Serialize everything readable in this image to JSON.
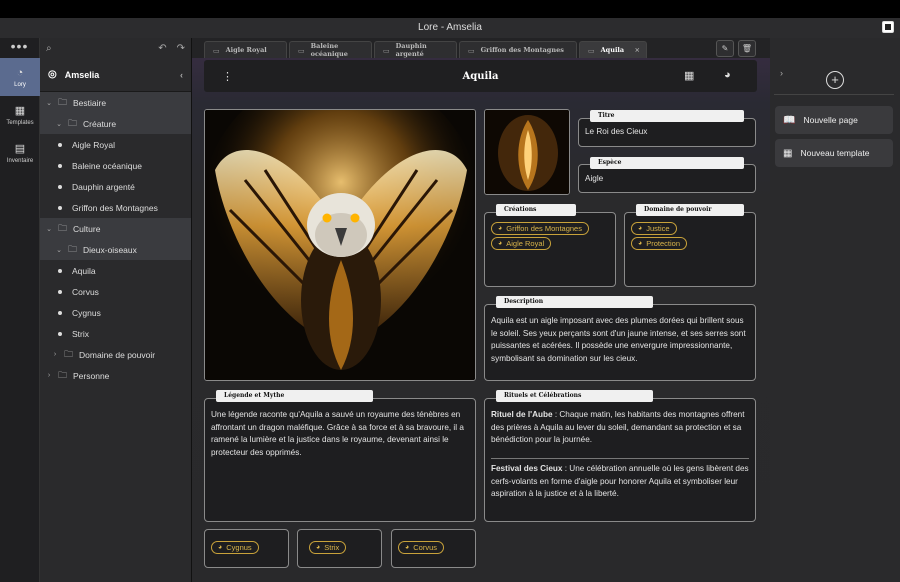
{
  "window": {
    "title": "Lore - Amselia"
  },
  "rail": {
    "items": [
      {
        "label": "Lory",
        "icon": "lory-icon"
      },
      {
        "label": "Templates",
        "icon": "templates-icon"
      },
      {
        "label": "Inventaire",
        "icon": "inventory-icon"
      }
    ]
  },
  "tree": {
    "workspace": "Amselia",
    "nodes": [
      {
        "label": "Bestiaire"
      },
      {
        "label": "Créature"
      },
      {
        "label": "Aigle Royal"
      },
      {
        "label": "Baleine océanique"
      },
      {
        "label": "Dauphin argenté"
      },
      {
        "label": "Griffon des Montagnes"
      },
      {
        "label": "Culture"
      },
      {
        "label": "Dieux-oiseaux"
      },
      {
        "label": "Aquila"
      },
      {
        "label": "Corvus"
      },
      {
        "label": "Cygnus"
      },
      {
        "label": "Strix"
      },
      {
        "label": "Domaine de pouvoir"
      },
      {
        "label": "Personne"
      }
    ]
  },
  "tabs": [
    {
      "label": "Aigle Royal"
    },
    {
      "label": "Baleine océanique"
    },
    {
      "label": "Dauphin argenté"
    },
    {
      "label": "Griffon des Montagnes"
    },
    {
      "label": "Aquila"
    }
  ],
  "page": {
    "title": "Aquila",
    "titre": {
      "label": "Titre",
      "value": "Le Roi des Cieux"
    },
    "espece": {
      "label": "Espèce",
      "value": "Aigle"
    },
    "creations": {
      "label": "Créations",
      "chips": [
        "Griffon des Montagnes",
        "Aigle Royal"
      ]
    },
    "domaine": {
      "label": "Domaine de pouvoir",
      "chips": [
        "Justice",
        "Protection"
      ]
    },
    "description": {
      "label": "Description",
      "text": "Aquila est un aigle imposant avec des plumes dorées qui brillent sous le soleil. Ses yeux perçants sont d'un jaune intense, et ses serres sont puissantes et acérées. Il possède une envergure impressionnante, symbolisant sa domination sur les cieux."
    },
    "legende": {
      "label": "Légende et Mythe",
      "text": "Une légende raconte qu'Aquila a sauvé un royaume des ténèbres en affrontant un dragon maléfique. Grâce à sa force et à sa bravoure, il a ramené la lumière et la justice dans le royaume, devenant ainsi le protecteur des opprimés."
    },
    "rituels": {
      "label": "Rituels et Célébrations",
      "r1_title": "Rituel de l'Aube",
      "r1_text": " : Chaque matin, les habitants des montagnes offrent des prières à Aquila au lever du soleil, demandant sa protection et sa bénédiction pour la journée.",
      "r2_title": "Festival des Cieux",
      "r2_text": " : Une célébration annuelle où les gens libèrent des cerfs-volants en forme d'aigle pour honorer Aquila et symboliser leur aspiration à la justice et à la liberté."
    },
    "related": [
      "Cygnus",
      "Strix",
      "Corvus"
    ]
  },
  "right_panel": {
    "new_page": "Nouvelle page",
    "new_template": "Nouveau template"
  },
  "colors": {
    "accent": "#5b6b8f",
    "chip": "#d9b44a"
  }
}
